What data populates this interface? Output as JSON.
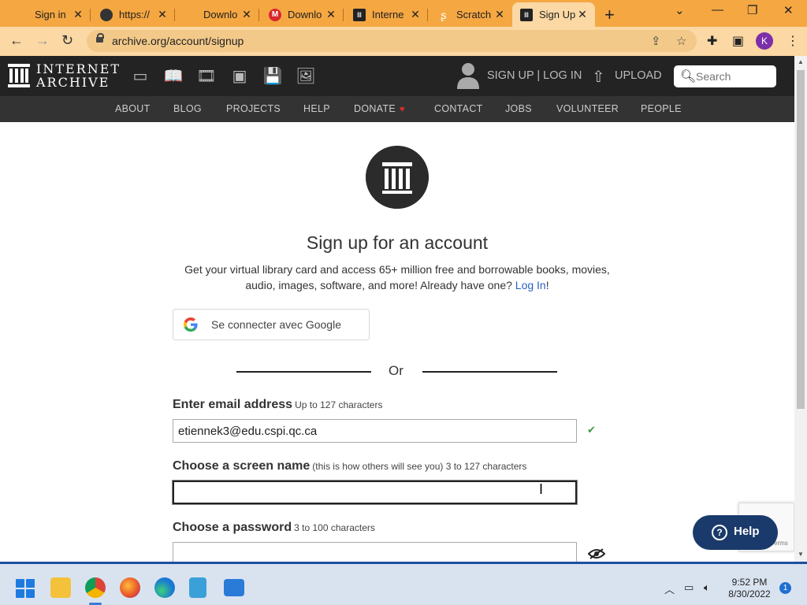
{
  "browser": {
    "tabs": [
      {
        "title": "Sign in",
        "favicon": "microsoft-icon"
      },
      {
        "title": "https://",
        "favicon": "globe-icon"
      },
      {
        "title": "Downlo",
        "favicon": "microsoft-icon"
      },
      {
        "title": "Downlo",
        "favicon": "mega-icon"
      },
      {
        "title": "Interne",
        "favicon": "internet-archive-icon"
      },
      {
        "title": "Scratch",
        "favicon": "scratch-icon"
      },
      {
        "title": "Sign Up",
        "favicon": "internet-archive-icon"
      }
    ],
    "url": "archive.org/account/signup",
    "profile_initial": "K",
    "colors": {
      "tabstrip": "#f5a742",
      "toolbar": "#fbd8a4"
    }
  },
  "header": {
    "logo_line1": "INTERNET",
    "logo_line2": "ARCHIVE",
    "signup_login": "SIGN UP | LOG IN",
    "upload": "UPLOAD",
    "search_placeholder": "Search",
    "media_icons": [
      "web-icon",
      "texts-icon",
      "video-icon",
      "audio-icon",
      "software-icon",
      "images-icon"
    ]
  },
  "nav": {
    "items": [
      "ABOUT",
      "BLOG",
      "PROJECTS",
      "HELP",
      "DONATE",
      "CONTACT",
      "JOBS",
      "VOLUNTEER",
      "PEOPLE"
    ]
  },
  "form": {
    "title": "Sign up for an account",
    "intro_text": "Get your virtual library card and access 65+ million free and borrowable books, movies, audio, images, software, and more! Already have one?",
    "login_link": "Log In",
    "intro_end": "!",
    "google_button": "Se connecter avec Google",
    "or": "Or",
    "email_label": "Enter email address",
    "email_hint": "Up to 127 characters",
    "email_value": "etiennek3@edu.cspi.qc.ca",
    "screen_name_label": "Choose a screen name",
    "screen_name_hint": "(this is how others will see you) 3 to 127 characters",
    "screen_name_value": "",
    "password_label": "Choose a password",
    "password_hint": "3 to 100 characters",
    "password_value": ""
  },
  "widgets": {
    "help_button": "Help",
    "recaptcha_text": "Terms"
  },
  "taskbar": {
    "time": "9:52 PM",
    "date": "8/30/2022",
    "notifications": "1",
    "apps": [
      "windows-start-icon",
      "file-explorer-icon",
      "chrome-icon",
      "firefox-icon",
      "edge-icon",
      "notepad-icon",
      "mail-icon"
    ]
  }
}
